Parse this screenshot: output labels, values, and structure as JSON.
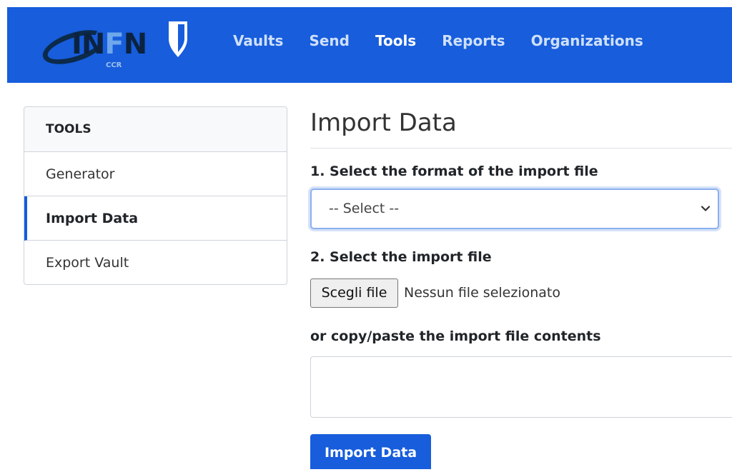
{
  "brand": {
    "logo_text_a": "IN",
    "logo_text_b": "F",
    "logo_text_c": "N",
    "logo_sub": "CCR"
  },
  "nav": {
    "items": [
      {
        "label": "Vaults"
      },
      {
        "label": "Send"
      },
      {
        "label": "Tools"
      },
      {
        "label": "Reports"
      },
      {
        "label": "Organizations"
      }
    ],
    "active": "Tools"
  },
  "sidebar": {
    "header": "TOOLS",
    "items": [
      {
        "label": "Generator"
      },
      {
        "label": "Import Data"
      },
      {
        "label": "Export Vault"
      }
    ],
    "active": "Import Data"
  },
  "main": {
    "title": "Import Data",
    "step1_label": "1. Select the format of the import file",
    "format_select": {
      "selected": "-- Select --"
    },
    "step2_label": "2. Select the import file",
    "file_button": "Scegli file",
    "file_status": "Nessun file selezionato",
    "paste_label": "or copy/paste the import file contents",
    "paste_value": "",
    "submit_label": "Import Data"
  },
  "colors": {
    "brand": "#175ddc",
    "nav_text": "#cfe0fb",
    "border": "#ced4da"
  }
}
